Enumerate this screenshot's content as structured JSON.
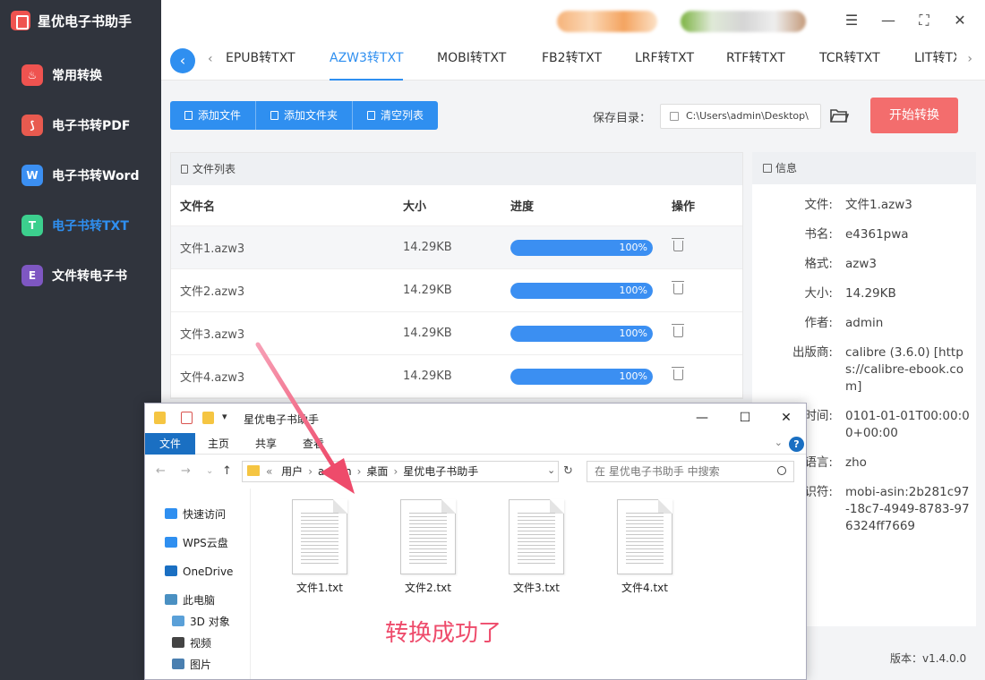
{
  "app": {
    "title": "星优电子书助手"
  },
  "sidebar": {
    "items": [
      {
        "label": "常用转换",
        "icon": "fire-icon",
        "color": "#ef5350",
        "active": false
      },
      {
        "label": "电子书转PDF",
        "icon": "pdf-icon",
        "color": "#e85a4f",
        "active": false
      },
      {
        "label": "电子书转Word",
        "icon": "word-icon",
        "color": "#3b8ff2",
        "active": false
      },
      {
        "label": "电子书转TXT",
        "icon": "txt-icon",
        "color": "#3ccf8e",
        "active": true
      },
      {
        "label": "文件转电子书",
        "icon": "ebook-icon",
        "color": "#7e57c2",
        "active": false
      }
    ]
  },
  "tabs": [
    "EPUB转TXT",
    "AZW3转TXT",
    "MOBI转TXT",
    "FB2转TXT",
    "LRF转TXT",
    "RTF转TXT",
    "TCR转TXT",
    "LIT转TXT"
  ],
  "active_tab": 1,
  "toolbar": {
    "add_file": "添加文件",
    "add_folder": "添加文件夹",
    "clear_list": "清空列表",
    "save_label": "保存目录：",
    "save_path": "C:\\Users\\admin\\Desktop\\",
    "start": "开始转换"
  },
  "filelist": {
    "title": "文件列表",
    "columns": [
      "文件名",
      "大小",
      "进度",
      "操作"
    ],
    "rows": [
      {
        "name": "文件1.azw3",
        "size": "14.29KB",
        "progress": 100,
        "progress_text": "100%"
      },
      {
        "name": "文件2.azw3",
        "size": "14.29KB",
        "progress": 100,
        "progress_text": "100%"
      },
      {
        "name": "文件3.azw3",
        "size": "14.29KB",
        "progress": 100,
        "progress_text": "100%"
      },
      {
        "name": "文件4.azw3",
        "size": "14.29KB",
        "progress": 100,
        "progress_text": "100%"
      }
    ]
  },
  "info": {
    "title": "信息",
    "fields": [
      {
        "k": "文件:",
        "v": "文件1.azw3"
      },
      {
        "k": "书名:",
        "v": "e4361pwa"
      },
      {
        "k": "格式:",
        "v": "azw3"
      },
      {
        "k": "大小:",
        "v": "14.29KB"
      },
      {
        "k": "作者:",
        "v": "admin"
      },
      {
        "k": "出版商:",
        "v": "calibre (3.6.0) [https://calibre-ebook.com]"
      },
      {
        "k": "时间:",
        "v": "0101-01-01T00:00:00+00:00"
      },
      {
        "k": "语言:",
        "v": "zho"
      },
      {
        "k": "识符:",
        "v": "mobi-asin:2b281c97-18c7-4949-8783-976324ff7669"
      }
    ],
    "version": "版本：v1.4.0.0"
  },
  "explorer": {
    "title": "星优电子书助手",
    "ribbon": [
      "文件",
      "主页",
      "共享",
      "查看"
    ],
    "breadcrumb": [
      "用户",
      "admin",
      "桌面",
      "星优电子书助手"
    ],
    "search_placeholder": "在 星优电子书助手 中搜索",
    "sidebar": [
      {
        "label": "快速访问",
        "icon": "star-icon",
        "color": "#2f8ff0"
      },
      {
        "label": "WPS云盘",
        "icon": "cloud-icon",
        "color": "#2f8ff0"
      },
      {
        "label": "OneDrive",
        "icon": "onedrive-icon",
        "color": "#1a6fc2"
      },
      {
        "label": "此电脑",
        "icon": "computer-icon",
        "color": "#4a90c2"
      },
      {
        "label": "3D 对象",
        "icon": "cube-icon",
        "color": "#5aa0d8"
      },
      {
        "label": "视频",
        "icon": "video-icon",
        "color": "#444444"
      },
      {
        "label": "图片",
        "icon": "picture-icon",
        "color": "#4a7fb0"
      }
    ],
    "files": [
      "文件1.txt",
      "文件2.txt",
      "文件3.txt",
      "文件4.txt"
    ]
  },
  "annotation": "转换成功了"
}
